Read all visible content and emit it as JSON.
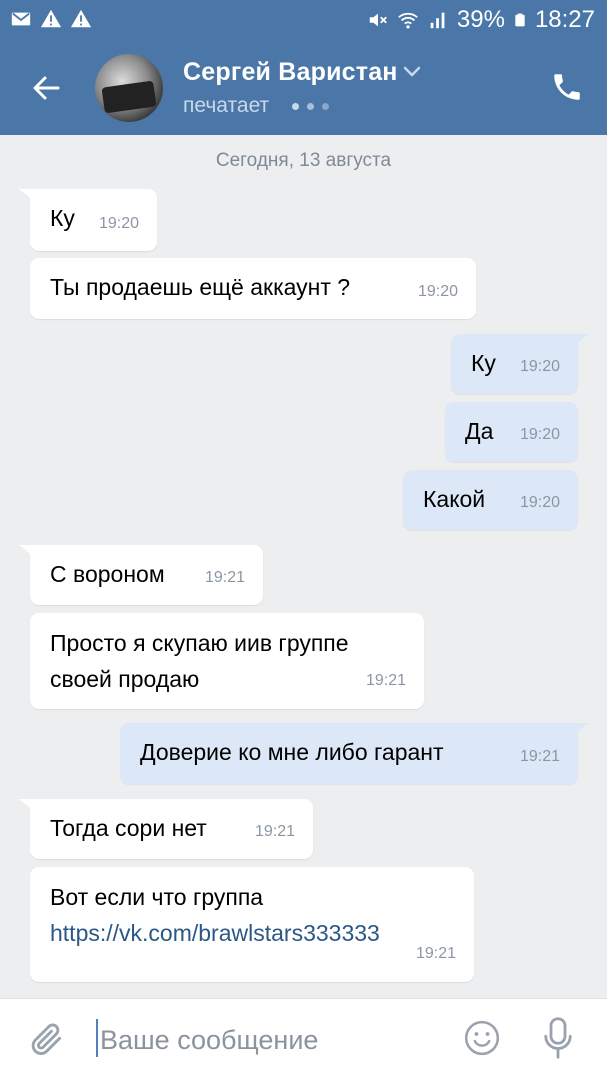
{
  "status_bar": {
    "battery_percent": "39%",
    "time": "18:27",
    "icons": [
      "mail-icon",
      "warning-icon",
      "warning-icon",
      "mute-icon",
      "wifi-icon",
      "signal-icon",
      "battery-icon"
    ]
  },
  "header": {
    "contact_name": "Сергей Варистан",
    "status": "печатает",
    "colors": {
      "bar": "#4a76a8",
      "text": "#ffffff",
      "status": "#c9d8ea"
    }
  },
  "date_separator": "Сегодня, 13 августа",
  "messages": [
    {
      "direction": "in",
      "text": "Ку",
      "time": "19:20"
    },
    {
      "direction": "in",
      "text": "Ты продаешь ещё аккаунт ?",
      "time": "19:20"
    },
    {
      "direction": "out",
      "text": "Ку",
      "time": "19:20"
    },
    {
      "direction": "out",
      "text": "Да",
      "time": "19:20"
    },
    {
      "direction": "out",
      "text": "Какой",
      "time": "19:20"
    },
    {
      "direction": "in",
      "text": "С вороном",
      "time": "19:21"
    },
    {
      "direction": "in",
      "text_line1": "Просто я скупаю иив группе",
      "text_line2": "своей продаю",
      "time": "19:21"
    },
    {
      "direction": "out",
      "text": "Доверие ко мне либо гарант",
      "time": "19:21"
    },
    {
      "direction": "in",
      "text": "Тогда сори нет",
      "time": "19:21"
    },
    {
      "direction": "in",
      "text": "Вот если что группа",
      "link": "https://vk.com/brawlstars333333",
      "time": "19:21"
    }
  ],
  "input": {
    "placeholder": "Ваше сообщение",
    "value": ""
  },
  "colors": {
    "background": "#edeef0",
    "incoming_bubble": "#ffffff",
    "outgoing_bubble": "#dce8f7",
    "link": "#2a5885",
    "timestamp": "#8c96a3"
  }
}
